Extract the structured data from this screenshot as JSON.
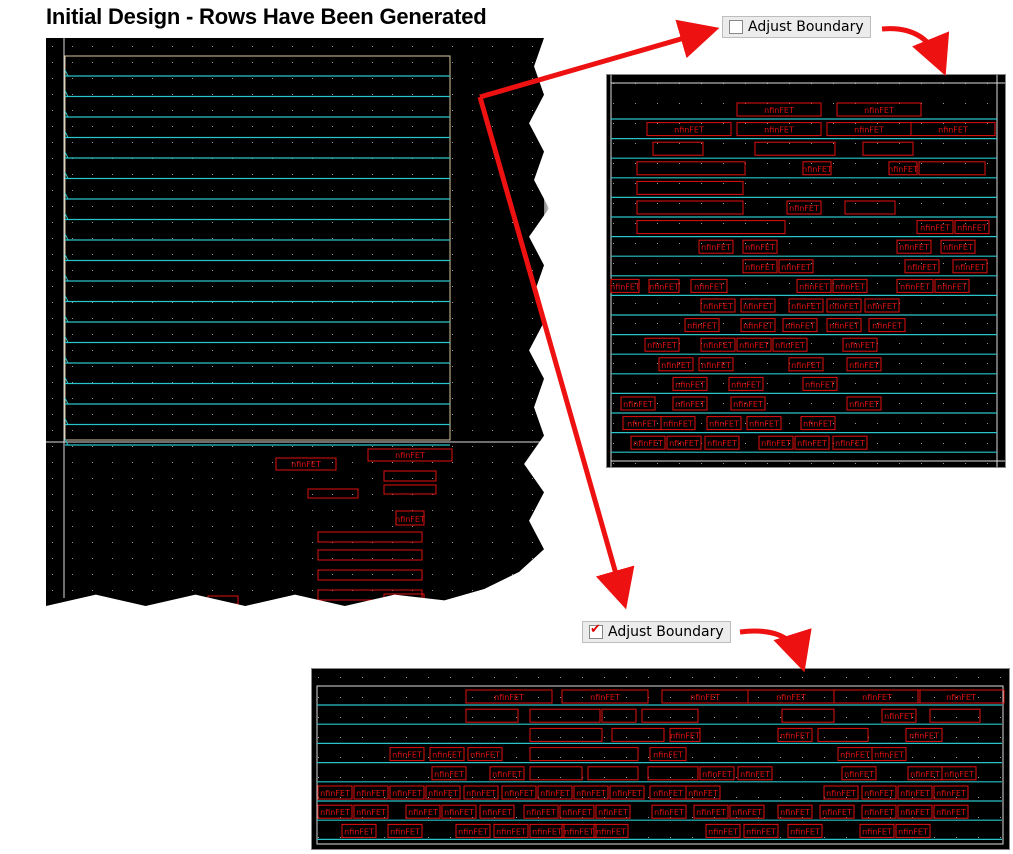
{
  "title": "Initial Design - Rows Have Been Generated",
  "top_control": {
    "label": "Adjust Boundary",
    "checked": false
  },
  "bottom_control": {
    "label": "Adjust Boundary",
    "checked": true
  },
  "cell_label": "nfinFET",
  "colors": {
    "row_line": "#29c4c8",
    "cell": "#e01010",
    "background": "#000000",
    "arrow": "#ee1111"
  },
  "panels": [
    {
      "id": "initial",
      "rows": 19
    },
    {
      "id": "unadjusted",
      "rows": 18
    },
    {
      "id": "adjusted",
      "rows": 8
    }
  ]
}
